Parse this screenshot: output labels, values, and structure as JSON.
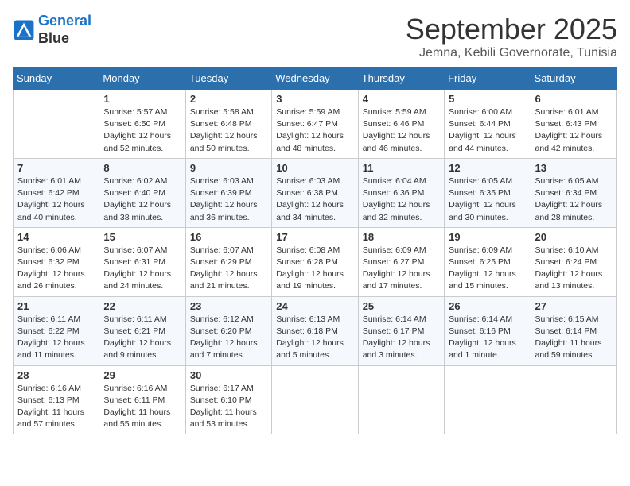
{
  "header": {
    "logo_line1": "General",
    "logo_line2": "Blue",
    "month_title": "September 2025",
    "subtitle": "Jemna, Kebili Governorate, Tunisia"
  },
  "days_of_week": [
    "Sunday",
    "Monday",
    "Tuesday",
    "Wednesday",
    "Thursday",
    "Friday",
    "Saturday"
  ],
  "weeks": [
    [
      {
        "day": "",
        "sunrise": "",
        "sunset": "",
        "daylight": ""
      },
      {
        "day": "1",
        "sunrise": "Sunrise: 5:57 AM",
        "sunset": "Sunset: 6:50 PM",
        "daylight": "Daylight: 12 hours and 52 minutes."
      },
      {
        "day": "2",
        "sunrise": "Sunrise: 5:58 AM",
        "sunset": "Sunset: 6:48 PM",
        "daylight": "Daylight: 12 hours and 50 minutes."
      },
      {
        "day": "3",
        "sunrise": "Sunrise: 5:59 AM",
        "sunset": "Sunset: 6:47 PM",
        "daylight": "Daylight: 12 hours and 48 minutes."
      },
      {
        "day": "4",
        "sunrise": "Sunrise: 5:59 AM",
        "sunset": "Sunset: 6:46 PM",
        "daylight": "Daylight: 12 hours and 46 minutes."
      },
      {
        "day": "5",
        "sunrise": "Sunrise: 6:00 AM",
        "sunset": "Sunset: 6:44 PM",
        "daylight": "Daylight: 12 hours and 44 minutes."
      },
      {
        "day": "6",
        "sunrise": "Sunrise: 6:01 AM",
        "sunset": "Sunset: 6:43 PM",
        "daylight": "Daylight: 12 hours and 42 minutes."
      }
    ],
    [
      {
        "day": "7",
        "sunrise": "Sunrise: 6:01 AM",
        "sunset": "Sunset: 6:42 PM",
        "daylight": "Daylight: 12 hours and 40 minutes."
      },
      {
        "day": "8",
        "sunrise": "Sunrise: 6:02 AM",
        "sunset": "Sunset: 6:40 PM",
        "daylight": "Daylight: 12 hours and 38 minutes."
      },
      {
        "day": "9",
        "sunrise": "Sunrise: 6:03 AM",
        "sunset": "Sunset: 6:39 PM",
        "daylight": "Daylight: 12 hours and 36 minutes."
      },
      {
        "day": "10",
        "sunrise": "Sunrise: 6:03 AM",
        "sunset": "Sunset: 6:38 PM",
        "daylight": "Daylight: 12 hours and 34 minutes."
      },
      {
        "day": "11",
        "sunrise": "Sunrise: 6:04 AM",
        "sunset": "Sunset: 6:36 PM",
        "daylight": "Daylight: 12 hours and 32 minutes."
      },
      {
        "day": "12",
        "sunrise": "Sunrise: 6:05 AM",
        "sunset": "Sunset: 6:35 PM",
        "daylight": "Daylight: 12 hours and 30 minutes."
      },
      {
        "day": "13",
        "sunrise": "Sunrise: 6:05 AM",
        "sunset": "Sunset: 6:34 PM",
        "daylight": "Daylight: 12 hours and 28 minutes."
      }
    ],
    [
      {
        "day": "14",
        "sunrise": "Sunrise: 6:06 AM",
        "sunset": "Sunset: 6:32 PM",
        "daylight": "Daylight: 12 hours and 26 minutes."
      },
      {
        "day": "15",
        "sunrise": "Sunrise: 6:07 AM",
        "sunset": "Sunset: 6:31 PM",
        "daylight": "Daylight: 12 hours and 24 minutes."
      },
      {
        "day": "16",
        "sunrise": "Sunrise: 6:07 AM",
        "sunset": "Sunset: 6:29 PM",
        "daylight": "Daylight: 12 hours and 21 minutes."
      },
      {
        "day": "17",
        "sunrise": "Sunrise: 6:08 AM",
        "sunset": "Sunset: 6:28 PM",
        "daylight": "Daylight: 12 hours and 19 minutes."
      },
      {
        "day": "18",
        "sunrise": "Sunrise: 6:09 AM",
        "sunset": "Sunset: 6:27 PM",
        "daylight": "Daylight: 12 hours and 17 minutes."
      },
      {
        "day": "19",
        "sunrise": "Sunrise: 6:09 AM",
        "sunset": "Sunset: 6:25 PM",
        "daylight": "Daylight: 12 hours and 15 minutes."
      },
      {
        "day": "20",
        "sunrise": "Sunrise: 6:10 AM",
        "sunset": "Sunset: 6:24 PM",
        "daylight": "Daylight: 12 hours and 13 minutes."
      }
    ],
    [
      {
        "day": "21",
        "sunrise": "Sunrise: 6:11 AM",
        "sunset": "Sunset: 6:22 PM",
        "daylight": "Daylight: 12 hours and 11 minutes."
      },
      {
        "day": "22",
        "sunrise": "Sunrise: 6:11 AM",
        "sunset": "Sunset: 6:21 PM",
        "daylight": "Daylight: 12 hours and 9 minutes."
      },
      {
        "day": "23",
        "sunrise": "Sunrise: 6:12 AM",
        "sunset": "Sunset: 6:20 PM",
        "daylight": "Daylight: 12 hours and 7 minutes."
      },
      {
        "day": "24",
        "sunrise": "Sunrise: 6:13 AM",
        "sunset": "Sunset: 6:18 PM",
        "daylight": "Daylight: 12 hours and 5 minutes."
      },
      {
        "day": "25",
        "sunrise": "Sunrise: 6:14 AM",
        "sunset": "Sunset: 6:17 PM",
        "daylight": "Daylight: 12 hours and 3 minutes."
      },
      {
        "day": "26",
        "sunrise": "Sunrise: 6:14 AM",
        "sunset": "Sunset: 6:16 PM",
        "daylight": "Daylight: 12 hours and 1 minute."
      },
      {
        "day": "27",
        "sunrise": "Sunrise: 6:15 AM",
        "sunset": "Sunset: 6:14 PM",
        "daylight": "Daylight: 11 hours and 59 minutes."
      }
    ],
    [
      {
        "day": "28",
        "sunrise": "Sunrise: 6:16 AM",
        "sunset": "Sunset: 6:13 PM",
        "daylight": "Daylight: 11 hours and 57 minutes."
      },
      {
        "day": "29",
        "sunrise": "Sunrise: 6:16 AM",
        "sunset": "Sunset: 6:11 PM",
        "daylight": "Daylight: 11 hours and 55 minutes."
      },
      {
        "day": "30",
        "sunrise": "Sunrise: 6:17 AM",
        "sunset": "Sunset: 6:10 PM",
        "daylight": "Daylight: 11 hours and 53 minutes."
      },
      {
        "day": "",
        "sunrise": "",
        "sunset": "",
        "daylight": ""
      },
      {
        "day": "",
        "sunrise": "",
        "sunset": "",
        "daylight": ""
      },
      {
        "day": "",
        "sunrise": "",
        "sunset": "",
        "daylight": ""
      },
      {
        "day": "",
        "sunrise": "",
        "sunset": "",
        "daylight": ""
      }
    ]
  ]
}
